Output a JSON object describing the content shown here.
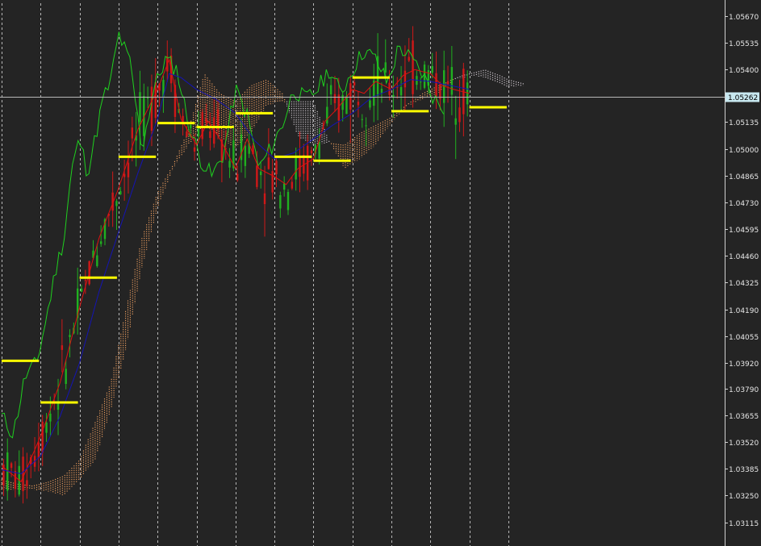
{
  "chart_data": {
    "type": "line",
    "title": "",
    "xlabel": "",
    "ylabel": "",
    "ylim": [
      1.0305,
      1.0572
    ],
    "y_ticks": [
      "1.05670",
      "1.05535",
      "1.05400",
      "1.05135",
      "1.05000",
      "1.04865",
      "1.04730",
      "1.04595",
      "1.04460",
      "1.04325",
      "1.04190",
      "1.04055",
      "1.03920",
      "1.03790",
      "1.03655",
      "1.03520",
      "1.03385",
      "1.03250",
      "1.03115"
    ],
    "current_price": 1.05262,
    "current_price_label": "1.05262",
    "period_count": 13,
    "grid": "vertical dashed period separators",
    "colors": {
      "background": "#242424",
      "axis_line": "#cfcfcf",
      "grid": "#d0d0d0",
      "chikou": "#1fd01f",
      "tenkan": "#e01010",
      "kijun": "#1414b4",
      "kumo_bull": "#f0a060",
      "kumo_bear": "#d8d0d8",
      "candle_up": "#20b020",
      "candle_down": "#d01818",
      "period_level": "#ffff00",
      "price_line": "#b8b8b8",
      "price_label_bg": "#c8e8f0"
    },
    "period_levels": [
      {
        "start": 0,
        "end": 1,
        "value": 1.0393
      },
      {
        "start": 1,
        "end": 2,
        "value": 1.0372
      },
      {
        "start": 2,
        "end": 3,
        "value": 1.0435
      },
      {
        "start": 3,
        "end": 4,
        "value": 1.0496
      },
      {
        "start": 4,
        "end": 5,
        "value": 1.0513
      },
      {
        "start": 5,
        "end": 6,
        "value": 1.0511
      },
      {
        "start": 6,
        "end": 7,
        "value": 1.0518
      },
      {
        "start": 7,
        "end": 8,
        "value": 1.0496
      },
      {
        "start": 8,
        "end": 9,
        "value": 1.0494
      },
      {
        "start": 9,
        "end": 10,
        "value": 1.0536
      },
      {
        "start": 10,
        "end": 11,
        "value": 1.0519
      },
      {
        "start": 12,
        "end": 13,
        "value": 1.0521
      }
    ],
    "series": [
      {
        "role": "chikou",
        "x": [
          0,
          0.3,
          0.6,
          0.9,
          1.1,
          1.4,
          1.6,
          1.8,
          2.0,
          2.2,
          2.4,
          2.6,
          2.8,
          3.0,
          3.3,
          3.6,
          3.9,
          4.2,
          4.5,
          4.8,
          5.1,
          5.4,
          5.7,
          6.0,
          6.3,
          6.6,
          6.9,
          7.2,
          7.5,
          7.8,
          8.1,
          8.4,
          8.7,
          9.0,
          9.3,
          9.6,
          9.9,
          10.2,
          10.5,
          10.8,
          11.1,
          11.4
        ],
        "values": [
          1.0365,
          1.0356,
          1.0385,
          1.0392,
          1.041,
          1.044,
          1.0455,
          1.049,
          1.0505,
          1.0488,
          1.0505,
          1.0525,
          1.0534,
          1.0558,
          1.0543,
          1.05,
          1.053,
          1.0545,
          1.054,
          1.0512,
          1.0495,
          1.0486,
          1.0498,
          1.053,
          1.0517,
          1.049,
          1.05,
          1.0512,
          1.053,
          1.0525,
          1.053,
          1.054,
          1.0528,
          1.054,
          1.055,
          1.0545,
          1.0533,
          1.0552,
          1.0545,
          1.0538,
          1.0525,
          1.052
        ]
      },
      {
        "role": "tenkan",
        "x": [
          0,
          0.5,
          1.0,
          1.5,
          2.0,
          2.5,
          3.0,
          3.5,
          4.0,
          4.3,
          4.6,
          5.0,
          5.3,
          5.6,
          6.0,
          6.3,
          6.6,
          7.0,
          7.3,
          7.6,
          8.0,
          8.3,
          8.6,
          9.0,
          9.3,
          9.6,
          10.0,
          10.3,
          10.6,
          11.0,
          11.3,
          11.6,
          12.0
        ],
        "values": [
          1.034,
          1.0332,
          1.0355,
          1.0382,
          1.042,
          1.0455,
          1.048,
          1.051,
          1.053,
          1.0545,
          1.0515,
          1.0502,
          1.0514,
          1.0505,
          1.049,
          1.0505,
          1.049,
          1.0486,
          1.0482,
          1.049,
          1.0495,
          1.0514,
          1.052,
          1.053,
          1.0528,
          1.0534,
          1.053,
          1.0537,
          1.054,
          1.0538,
          1.0532,
          1.053,
          1.0528
        ]
      },
      {
        "role": "kijun",
        "x": [
          0,
          0.5,
          1.0,
          1.5,
          2.0,
          2.5,
          3.0,
          3.5,
          4.0,
          4.3,
          4.6,
          5.0,
          5.5,
          6.0,
          6.5,
          7.0,
          7.5,
          8.0,
          8.5,
          9.0,
          9.5,
          10.0,
          10.5,
          11.0,
          11.5,
          12.0
        ],
        "values": [
          1.0338,
          1.0336,
          1.0345,
          1.0365,
          1.0392,
          1.0428,
          1.0458,
          1.0488,
          1.0515,
          1.0538,
          1.0536,
          1.053,
          1.0525,
          1.0518,
          1.0504,
          1.0495,
          1.0498,
          1.0505,
          1.0512,
          1.0518,
          1.0526,
          1.053,
          1.0535,
          1.0534,
          1.0532,
          1.053
        ]
      }
    ],
    "kumo": {
      "x": [
        0,
        0.4,
        0.8,
        1.2,
        1.6,
        2.0,
        2.4,
        2.8,
        3.2,
        3.6,
        4.0,
        4.4,
        4.8,
        5.2,
        5.6,
        6.0,
        6.4,
        6.8,
        7.2,
        7.6,
        8.0,
        8.4,
        8.8,
        9.2,
        9.6,
        10.0,
        10.4,
        10.8,
        11.2,
        11.6,
        12.0,
        12.4,
        12.8,
        13.0,
        13.4
      ],
      "span_a": [
        1.0333,
        1.0331,
        1.033,
        1.0332,
        1.0335,
        1.0343,
        1.0362,
        1.0382,
        1.042,
        1.0455,
        1.0478,
        1.0492,
        1.051,
        1.0538,
        1.0528,
        1.0524,
        1.0532,
        1.0535,
        1.0528,
        1.0506,
        1.0502,
        1.0503,
        1.0502,
        1.0508,
        1.0512,
        1.0516,
        1.0522,
        1.0528,
        1.0532,
        1.0535,
        1.0537,
        1.0536,
        1.0533,
        1.0531,
        1.0532
      ],
      "span_b": [
        1.0328,
        1.0328,
        1.0328,
        1.0327,
        1.0325,
        1.0333,
        1.0343,
        1.0368,
        1.04,
        1.044,
        1.047,
        1.049,
        1.0502,
        1.0512,
        1.0506,
        1.05,
        1.0508,
        1.0522,
        1.0524,
        1.0524,
        1.0524,
        1.0504,
        1.049,
        1.0495,
        1.0502,
        1.0513,
        1.0522,
        1.0525,
        1.0528,
        1.0535,
        1.0538,
        1.054,
        1.0537,
        1.0535,
        1.0533
      ]
    },
    "candles_seed": 7,
    "candles_per_period": 10
  }
}
